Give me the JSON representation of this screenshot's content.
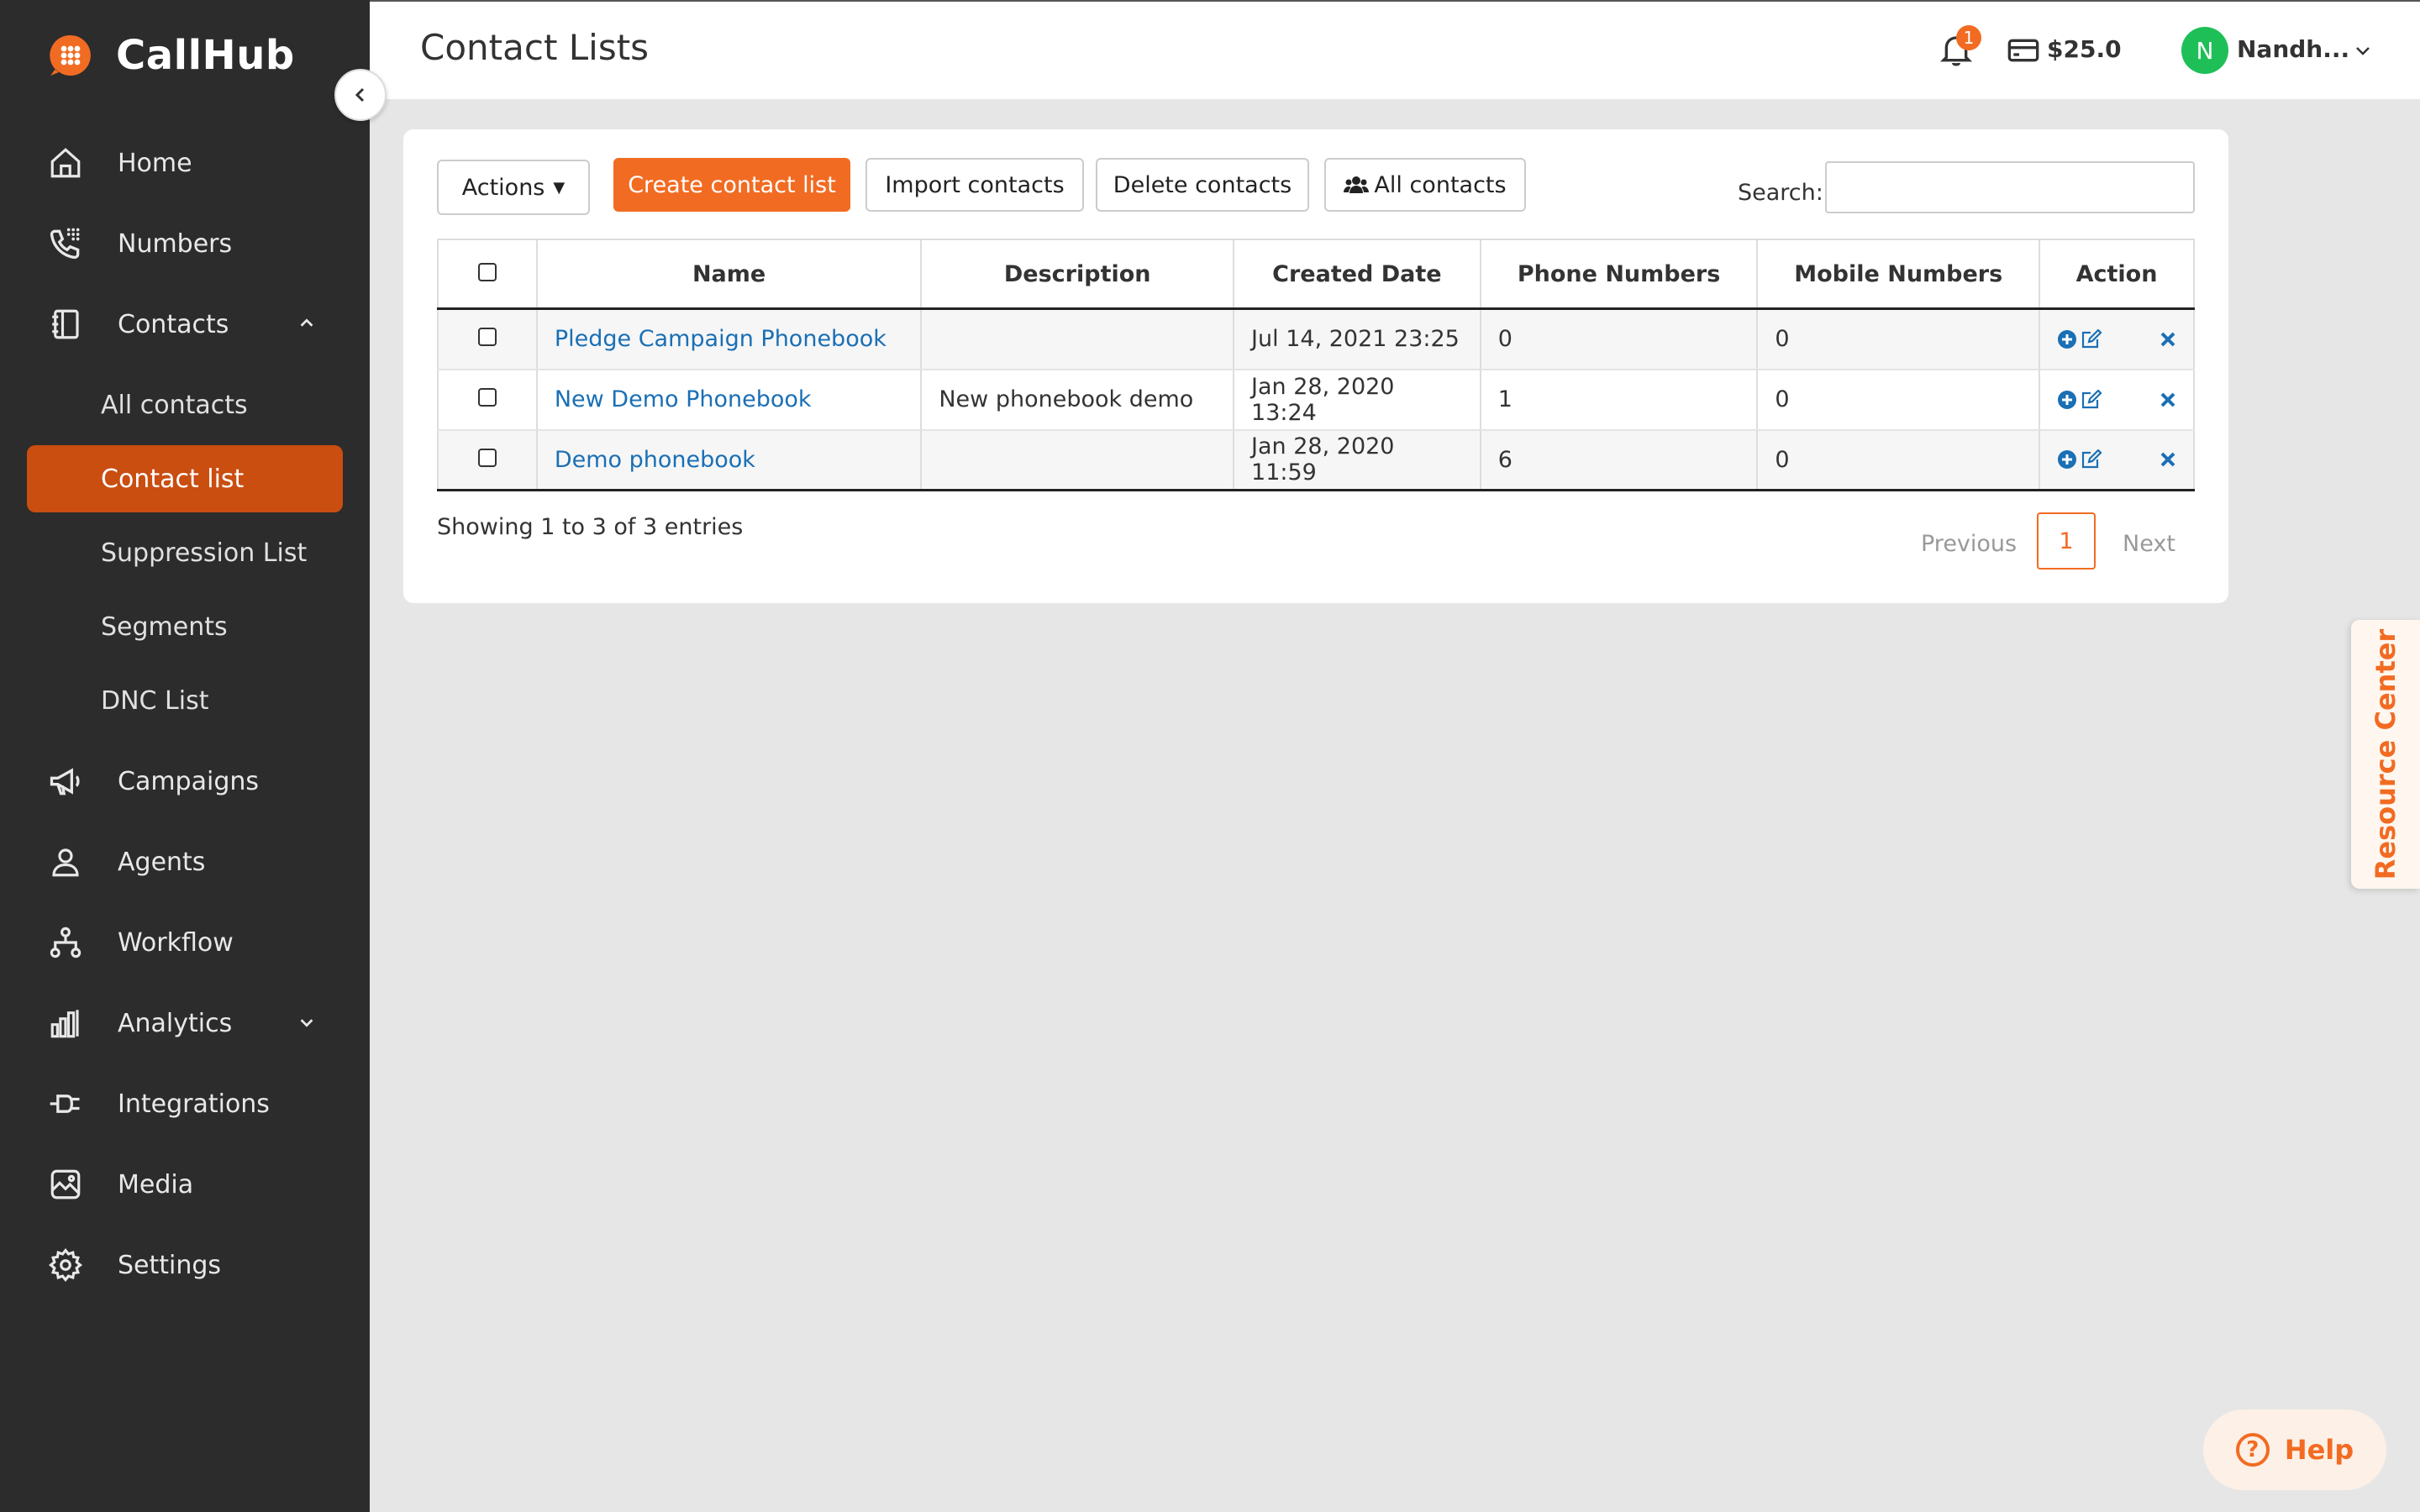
{
  "app": {
    "brand": "CallHub"
  },
  "colors": {
    "accent": "#f26b22",
    "active_nav": "#c94e10",
    "sidebar_bg": "#2c2c2c",
    "link": "#1a6fb5",
    "avatar_bg": "#1fbf58"
  },
  "sidebar": {
    "home": "Home",
    "numbers": "Numbers",
    "contacts": "Contacts",
    "contacts_sub": {
      "all_contacts": "All contacts",
      "contact_list": "Contact list",
      "suppression_list": "Suppression List",
      "segments": "Segments",
      "dnc_list": "DNC List"
    },
    "campaigns": "Campaigns",
    "agents": "Agents",
    "workflow": "Workflow",
    "analytics": "Analytics",
    "integrations": "Integrations",
    "media": "Media",
    "settings": "Settings"
  },
  "header": {
    "title": "Contact Lists",
    "notification_count": "1",
    "balance": "$25.0",
    "avatar_letter": "N",
    "user_name": "Nandh..."
  },
  "toolbar": {
    "actions": "Actions",
    "create": "Create contact list",
    "import": "Import contacts",
    "delete": "Delete contacts",
    "all_contacts": "All contacts",
    "search_label": "Search:",
    "search_value": ""
  },
  "table": {
    "columns": [
      "Name",
      "Description",
      "Created Date",
      "Phone Numbers",
      "Mobile Numbers",
      "Action"
    ],
    "rows": [
      {
        "name": "Pledge Campaign Phonebook",
        "description": "",
        "created": "Jul 14, 2021 23:25",
        "phone": "0",
        "mobile": "0"
      },
      {
        "name": "New Demo Phonebook",
        "description": "New phonebook demo",
        "created": "Jan 28, 2020 13:24",
        "phone": "1",
        "mobile": "0"
      },
      {
        "name": "Demo phonebook",
        "description": "",
        "created": "Jan 28, 2020 11:59",
        "phone": "6",
        "mobile": "0"
      }
    ]
  },
  "footer": {
    "showing": "Showing 1 to 3 of 3 entries"
  },
  "pagination": {
    "previous": "Previous",
    "page": "1",
    "next": "Next"
  },
  "resource_center": "Resource Center",
  "help": "Help"
}
